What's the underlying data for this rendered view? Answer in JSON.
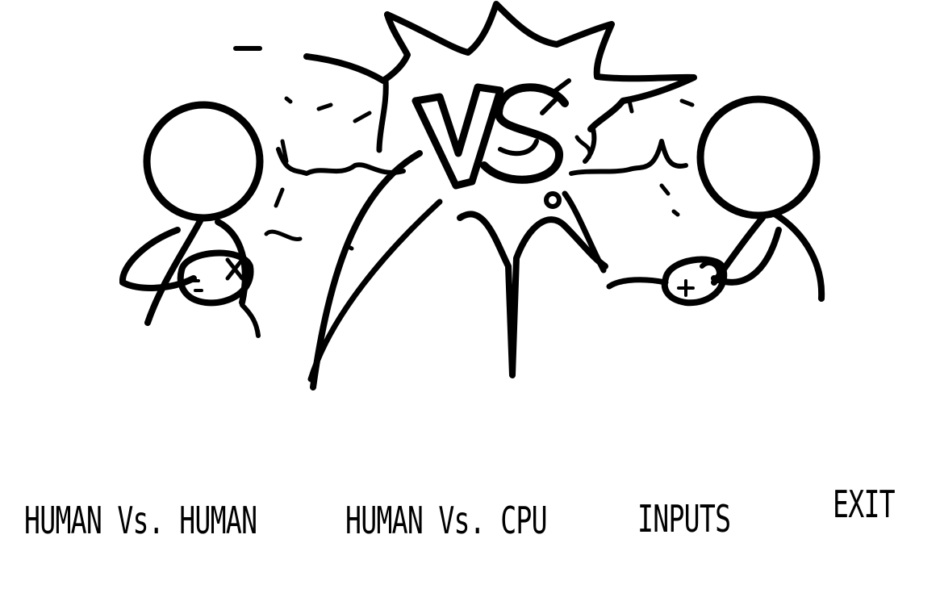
{
  "title_art": {
    "vs_text": "VS"
  },
  "menu": {
    "selected_index": 0,
    "items": [
      {
        "label": "HUMAN Vs. HUMAN"
      },
      {
        "label": "HUMAN Vs. CPU"
      },
      {
        "label": "INPUTS"
      },
      {
        "label": "EXIT"
      }
    ]
  },
  "colors": {
    "background": "#ffffff",
    "ink": "#000000",
    "selected_paper": "#dcdcdc"
  }
}
